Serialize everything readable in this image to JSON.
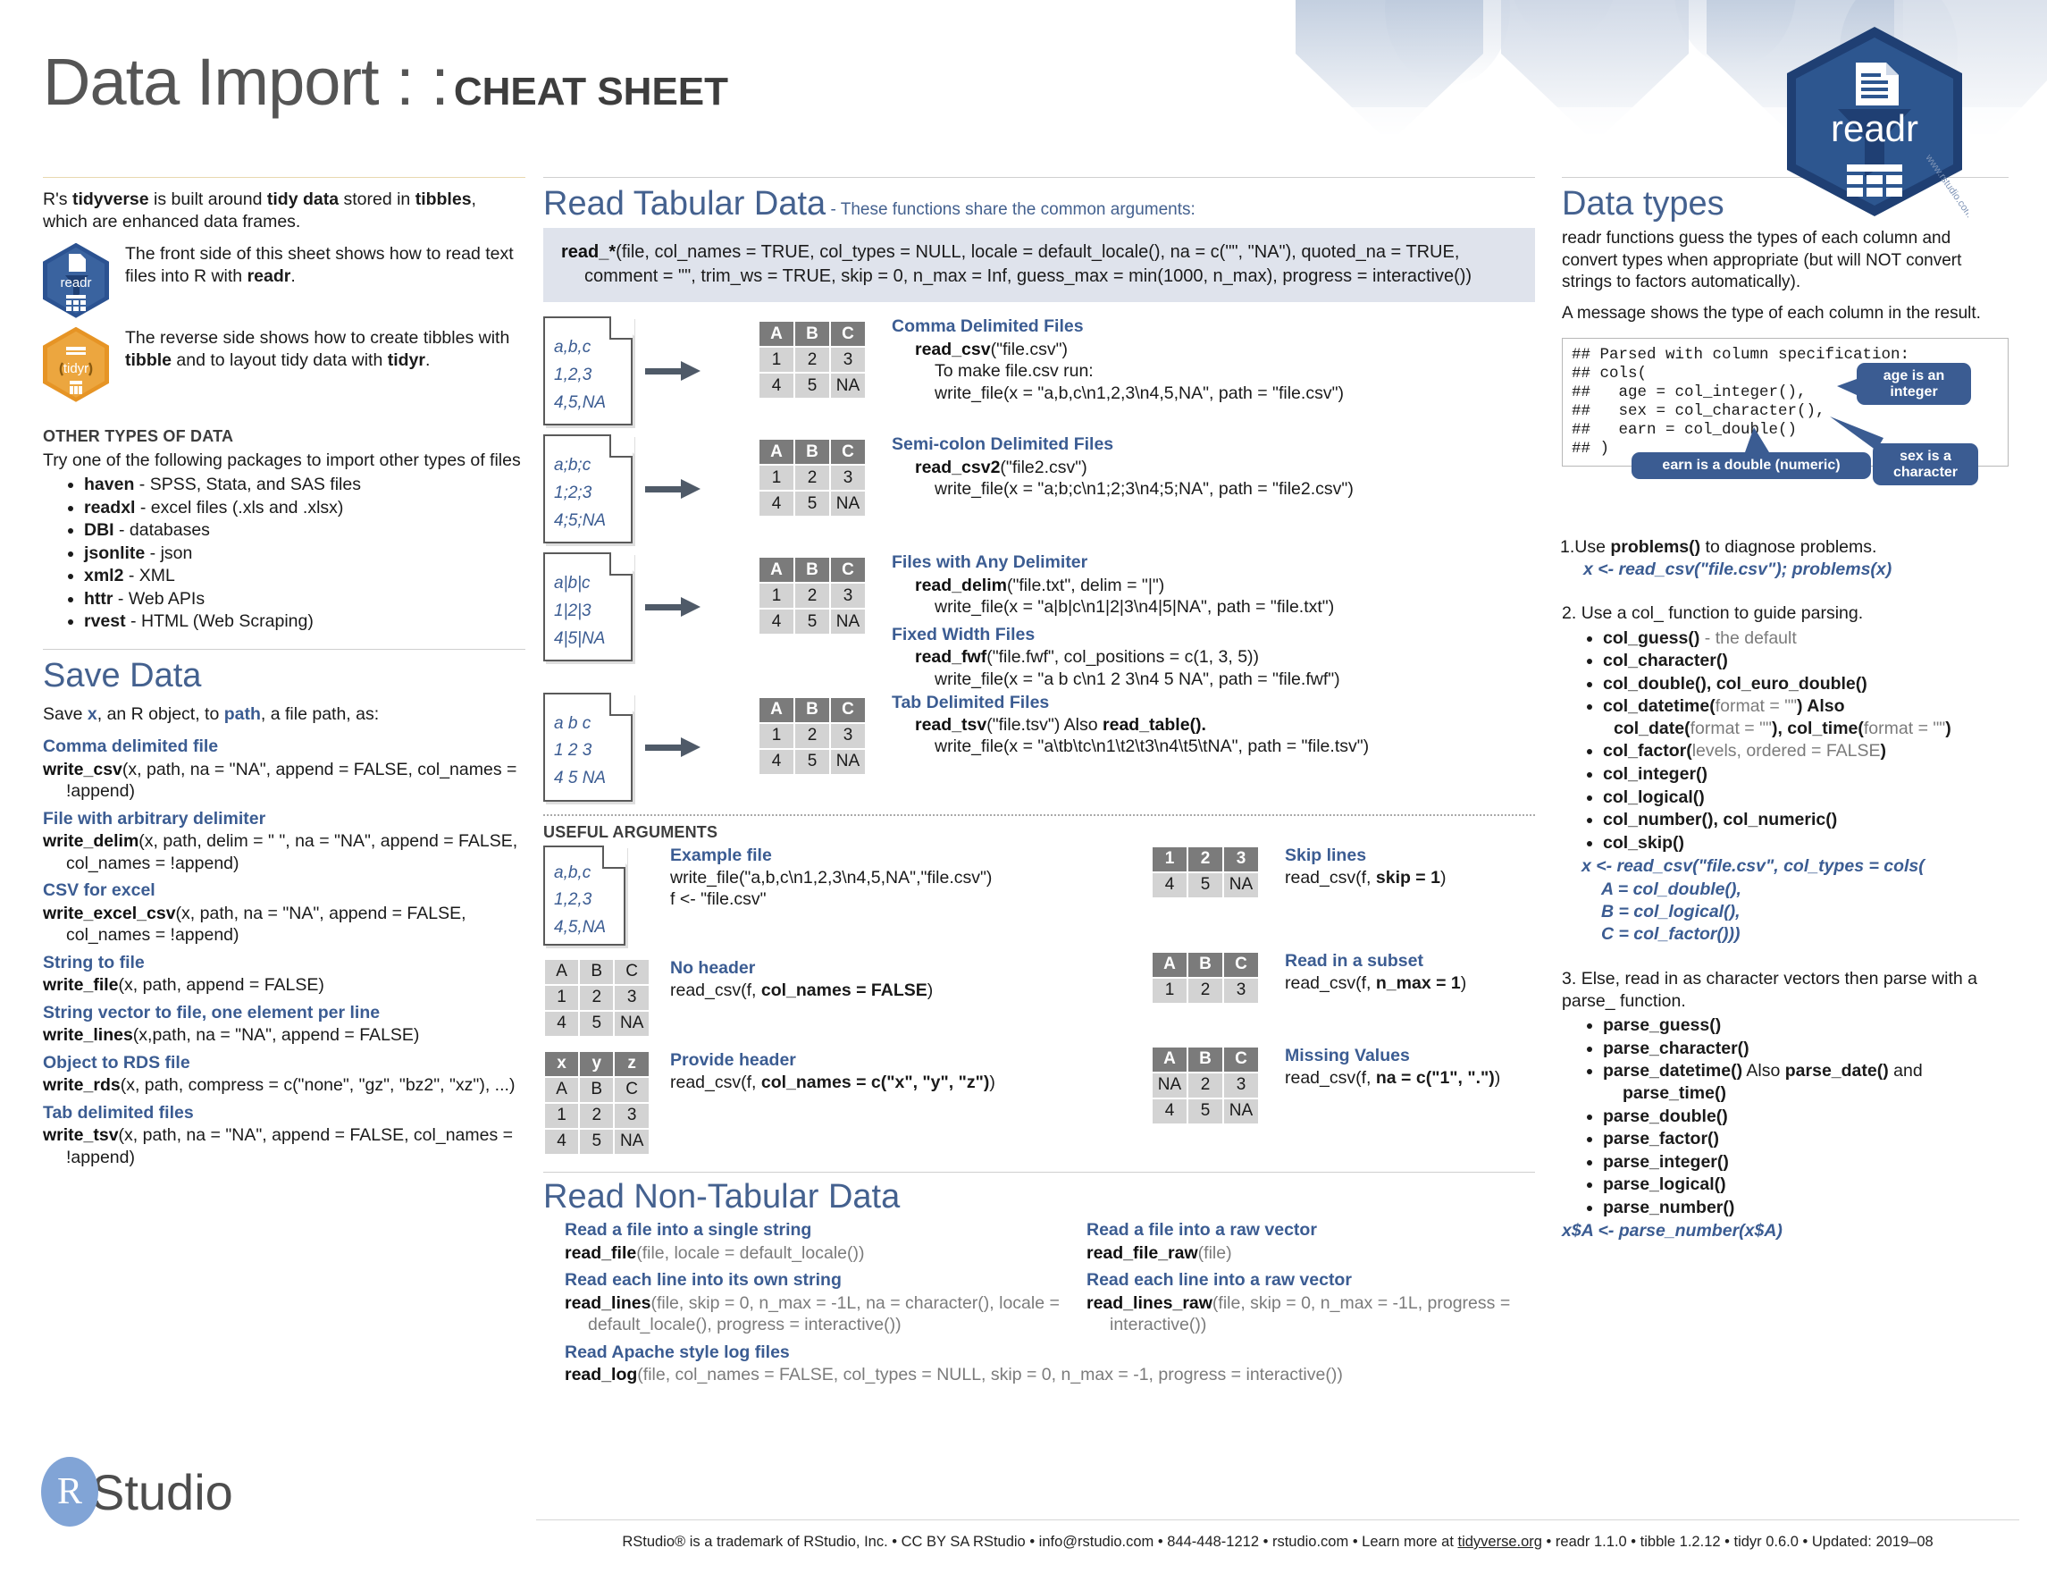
{
  "header": {
    "title_main": "Data Import : :",
    "title_sub": "CHEAT SHEET",
    "hex_readr_label": "readr",
    "hex_tidyr_label": "tidyr"
  },
  "intro": {
    "line1_pre": "R's ",
    "line1_b1": "tidyverse",
    "line1_mid": " is built around ",
    "line1_b2": "tidy data",
    "line1_post": " stored in ",
    "line1_b3": "tibbles",
    "line1_end": ", which are enhanced data frames.",
    "readr_text_pre": "The front side of this sheet shows how to read text files into R with ",
    "readr_text_b": "readr",
    "readr_text_post": ".",
    "tidyr_text_pre": "The reverse side shows how to create tibbles with ",
    "tidyr_text_b1": "tibble",
    "tidyr_text_mid": " and to layout tidy data with ",
    "tidyr_text_b2": "tidyr",
    "tidyr_text_post": "."
  },
  "other_types": {
    "heading": "OTHER TYPES OF DATA",
    "lead": "Try one of the following packages to import other types of files",
    "items": [
      {
        "name": "haven",
        "desc": " - SPSS, Stata, and SAS files"
      },
      {
        "name": "readxl",
        "desc": " - excel files (.xls and .xlsx)"
      },
      {
        "name": "DBI",
        "desc": " - databases"
      },
      {
        "name": "jsonlite",
        "desc": " - json"
      },
      {
        "name": "xml2",
        "desc": " - XML"
      },
      {
        "name": "httr",
        "desc": " - Web APIs"
      },
      {
        "name": "rvest",
        "desc": " - HTML (Web Scraping)"
      }
    ]
  },
  "save_data": {
    "title": "Save Data",
    "lead_pre": "Save ",
    "lead_x": "x",
    "lead_mid": ", an R object, to ",
    "lead_path": "path",
    "lead_post": ", a file path, as:",
    "entries": [
      {
        "heading": "Comma delimited file",
        "fn": "write_csv",
        "args": "(x, path, na = \"NA\", append = FALSE, col_names = !append)"
      },
      {
        "heading": "File with arbitrary delimiter",
        "fn": "write_delim",
        "args": "(x, path, delim = \" \", na = \"NA\", append = FALSE, col_names = !append)"
      },
      {
        "heading": "CSV for excel",
        "fn": "write_excel_csv",
        "args": "(x, path, na = \"NA\", append = FALSE, col_names = !append)"
      },
      {
        "heading": "String to file",
        "fn": "write_file",
        "args": "(x, path, append = FALSE)"
      },
      {
        "heading": "String vector to file, one element per line",
        "fn": "write_lines",
        "args": "(x,path, na = \"NA\", append = FALSE)"
      },
      {
        "heading": "Object to RDS file",
        "fn": "write_rds",
        "args": "(x, path, compress = c(\"none\", \"gz\", \"bz2\", \"xz\"), ...)"
      },
      {
        "heading": "Tab delimited files",
        "fn": "write_tsv",
        "args": "(x, path, na = \"NA\", append = FALSE, col_names = !append)"
      }
    ]
  },
  "read_tabular": {
    "title": "Read Tabular Data",
    "subtitle": " - These functions share the common arguments:",
    "common_args": "read_*(file, col_names = TRUE, col_types = NULL, locale = default_locale(), na = c(\"\", \"NA\"), quoted_na = TRUE, comment = \"\", trim_ws = TRUE, skip = 0, n_max = Inf, guess_max = min(1000, n_max), progress = interactive())",
    "common_args_fn": "read_*",
    "rows": [
      {
        "file_lines": [
          "a,b,c",
          "1,2,3",
          "4,5,NA"
        ],
        "table_header": [
          "A",
          "B",
          "C"
        ],
        "table_rows": [
          [
            "1",
            "2",
            "3"
          ],
          [
            "4",
            "5",
            "NA"
          ]
        ],
        "heading": "Comma Delimited Files",
        "fn": "read_csv",
        "fn_args": "(\"file.csv\")",
        "note": "To make file.csv run:",
        "extra": "write_file(x = \"a,b,c\\n1,2,3\\n4,5,NA\", path = \"file.csv\")"
      },
      {
        "file_lines": [
          "a;b;c",
          "1;2;3",
          "4;5;NA"
        ],
        "table_header": [
          "A",
          "B",
          "C"
        ],
        "table_rows": [
          [
            "1",
            "2",
            "3"
          ],
          [
            "4",
            "5",
            "NA"
          ]
        ],
        "heading": "Semi-colon Delimited Files",
        "fn": "read_csv2",
        "fn_args": "(\"file2.csv\")",
        "note": "",
        "extra": "write_file(x = \"a;b;c\\n1;2;3\\n4;5;NA\", path = \"file2.csv\")"
      },
      {
        "file_lines": [
          "a|b|c",
          "1|2|3",
          "4|5|NA"
        ],
        "table_header": [
          "A",
          "B",
          "C"
        ],
        "table_rows": [
          [
            "1",
            "2",
            "3"
          ],
          [
            "4",
            "5",
            "NA"
          ]
        ],
        "heading": "Files with Any Delimiter",
        "fn": "read_delim",
        "fn_args": "(\"file.txt\", delim = \"|\")",
        "note": "",
        "extra": "write_file(x = \"a|b|c\\n1|2|3\\n4|5|NA\", path = \"file.txt\")"
      },
      {
        "file_lines": [
          "a b c",
          "1 2 3",
          "4 5 NA"
        ],
        "table_header": [
          "A",
          "B",
          "C"
        ],
        "table_rows": [
          [
            "1",
            "2",
            "3"
          ],
          [
            "4",
            "5",
            "NA"
          ]
        ],
        "heading": "Fixed Width Files",
        "fn": "read_fwf",
        "fn_args": "(\"file.fwf\", col_positions = c(1, 3, 5))",
        "note": "",
        "extra": "write_file(x = \"a b c\\n1 2 3\\n4 5 NA\", path = \"file.fwf\")"
      },
      {
        "file_lines": [],
        "table_header": [],
        "table_rows": [],
        "heading": "Tab Delimited Files",
        "fn": "read_tsv",
        "fn_args": "(\"file.tsv\") Also read_table().",
        "note": "",
        "extra": "write_file(x = \"a\\tb\\tc\\n1\\t2\\t3\\n4\\t5\\tNA\", path = \"file.tsv\")"
      }
    ]
  },
  "useful_arguments": {
    "heading": "USEFUL ARGUMENTS",
    "left": [
      {
        "kind": "file",
        "file_lines": [
          "a,b,c",
          "1,2,3",
          "4,5,NA"
        ],
        "heading": "Example file",
        "code1": "write_file(\"a,b,c\\n1,2,3\\n4,5,NA\",\"file.csv\")",
        "code2": "f <- \"file.csv\""
      },
      {
        "kind": "table",
        "table_header": [
          "A",
          "B",
          "C"
        ],
        "header_is_grey": true,
        "table_rows": [
          [
            "1",
            "2",
            "3"
          ],
          [
            "4",
            "5",
            "NA"
          ]
        ],
        "heading": "No header",
        "code_pre": "read_csv(f, ",
        "code_b": "col_names = FALSE",
        "code_post": ")"
      },
      {
        "kind": "table",
        "table_header": [
          "x",
          "y",
          "z"
        ],
        "header_is_grey": false,
        "table_rows": [
          [
            "A",
            "B",
            "C"
          ],
          [
            "1",
            "2",
            "3"
          ],
          [
            "4",
            "5",
            "NA"
          ]
        ],
        "heading": "Provide header",
        "code_pre": "read_csv(f, ",
        "code_b": "col_names = c(\"x\", \"y\", \"z\")",
        "code_post": ")"
      }
    ],
    "right": [
      {
        "table_header": [
          "1",
          "2",
          "3"
        ],
        "table_rows": [
          [
            "4",
            "5",
            "NA"
          ]
        ],
        "heading": "Skip lines",
        "code_pre": "read_csv(f, ",
        "code_b": "skip = 1",
        "code_post": ")"
      },
      {
        "table_header": [
          "A",
          "B",
          "C"
        ],
        "table_rows": [
          [
            "1",
            "2",
            "3"
          ]
        ],
        "heading": "Read in a subset",
        "code_pre": "read_csv(f, ",
        "code_b": "n_max = 1",
        "code_post": ")"
      },
      {
        "table_header": [
          "A",
          "B",
          "C"
        ],
        "table_rows": [
          [
            "NA",
            "2",
            "3"
          ],
          [
            "4",
            "5",
            "NA"
          ]
        ],
        "heading": "Missing Values",
        "code_pre": "read_csv(f, ",
        "code_b": "na = c(\"1\", \".\")",
        "code_post": ")"
      }
    ]
  },
  "read_non_tabular": {
    "title": "Read Non-Tabular Data",
    "left": [
      {
        "heading": "Read a file into a single string",
        "fn": "read_file",
        "args": "(file, locale = default_locale())"
      },
      {
        "heading": "Read each line into its own string",
        "fn": "read_lines",
        "args": "(file, skip = 0, n_max = -1L, na = character(), locale = default_locale(), progress = interactive())"
      },
      {
        "heading": "Read Apache style log files",
        "fn": "read_log",
        "args": "(file, col_names = FALSE, col_types = NULL, skip = 0, n_max = -1, progress = interactive())"
      }
    ],
    "right": [
      {
        "heading": "Read a file into a raw vector",
        "fn": "read_file_raw",
        "args": "(file)"
      },
      {
        "heading": "Read each line into a raw vector",
        "fn": "read_lines_raw",
        "args": "(file, skip = 0, n_max = -1L, progress = interactive())"
      }
    ]
  },
  "data_types": {
    "title": "Data types",
    "para1": "readr functions guess the types of each column and convert types when appropriate (but will NOT convert strings to factors automatically).",
    "para2": "A message shows the type of each column in the result.",
    "console": "## Parsed with column specification:\n## cols(\n##   age = col_integer(),\n##   sex = col_character(),\n##   earn = col_double()\n## )",
    "callouts": [
      {
        "text": "age is an integer"
      },
      {
        "text": "sex is a character"
      },
      {
        "text": "earn is a double (numeric)"
      }
    ],
    "step1": {
      "num": "1.",
      "pre": "Use ",
      "b": "problems()",
      "post": " to diagnose problems.",
      "code": "x <- read_csv(\"file.csv\"); problems(x)"
    },
    "step2": {
      "num": "2.",
      "text": "Use a col_ function to guide parsing.",
      "items": [
        {
          "b": "col_guess()",
          "grey": " - the default"
        },
        {
          "b": "col_character()",
          "grey": ""
        },
        {
          "b": "col_double(), col_euro_double()",
          "grey": ""
        },
        {
          "b": "col_datetime(",
          "grey": "format = \"\"",
          "b2": ") Also",
          "line2_b": "col_date(",
          "line2_grey": "format = \"\"",
          "line2_b2": "), col_time(",
          "line2_grey2": "format = \"\"",
          "line2_b3": ")"
        },
        {
          "b": "col_factor(",
          "grey": "levels, ordered = FALSE",
          "b2": ")"
        },
        {
          "b": "col_integer()",
          "grey": ""
        },
        {
          "b": "col_logical()",
          "grey": ""
        },
        {
          "b": "col_number(), col_numeric()",
          "grey": ""
        },
        {
          "b": "col_skip()",
          "grey": ""
        }
      ],
      "code_lines": [
        "x <- read_csv(\"file.csv\", col_types = cols(",
        "A = col_double(),",
        "B = col_logical(),",
        "C = col_factor()))"
      ]
    },
    "step3": {
      "num": "3.",
      "text": "Else, read in as character vectors then parse with a parse_ function.",
      "items": [
        {
          "b": "parse_guess()",
          "grey": ""
        },
        {
          "b": "parse_character()",
          "grey": ""
        },
        {
          "b": "parse_datetime()",
          "grey": " Also ",
          "b2": "parse_date()",
          "grey2": " and",
          "line2": "parse_time()"
        },
        {
          "b": "parse_double()",
          "grey": ""
        },
        {
          "b": "parse_factor()",
          "grey": ""
        },
        {
          "b": "parse_integer()",
          "grey": ""
        },
        {
          "b": "parse_logical()",
          "grey": ""
        },
        {
          "b": "parse_number()",
          "grey": ""
        }
      ],
      "code": "x$A <- parse_number(x$A)"
    }
  },
  "footer": {
    "text_parts": [
      "RStudio",
      "® is a trademark of RStudio, Inc.  •  CC BY SA  RStudio •  info@rstudio.com  •  844-448-1212 • rstudio.com  •  Learn more at ",
      "tidyverse.org",
      " •  readr  1.1.0 •  tibble  1.2.12 •  tidyr  0.6.0 •  Updated: 2019–08"
    ],
    "logo_letter": "R",
    "logo_word": "Studio"
  },
  "colors": {
    "accent_blue": "#3b5c92",
    "heading_blue": "#44618f",
    "readr_hex": "#2b5291",
    "tidyr_hex": "#e69425",
    "table_header": "#7b7b7b",
    "table_cell": "#d3d3d3",
    "argbox_bg": "#dfe3ec"
  }
}
